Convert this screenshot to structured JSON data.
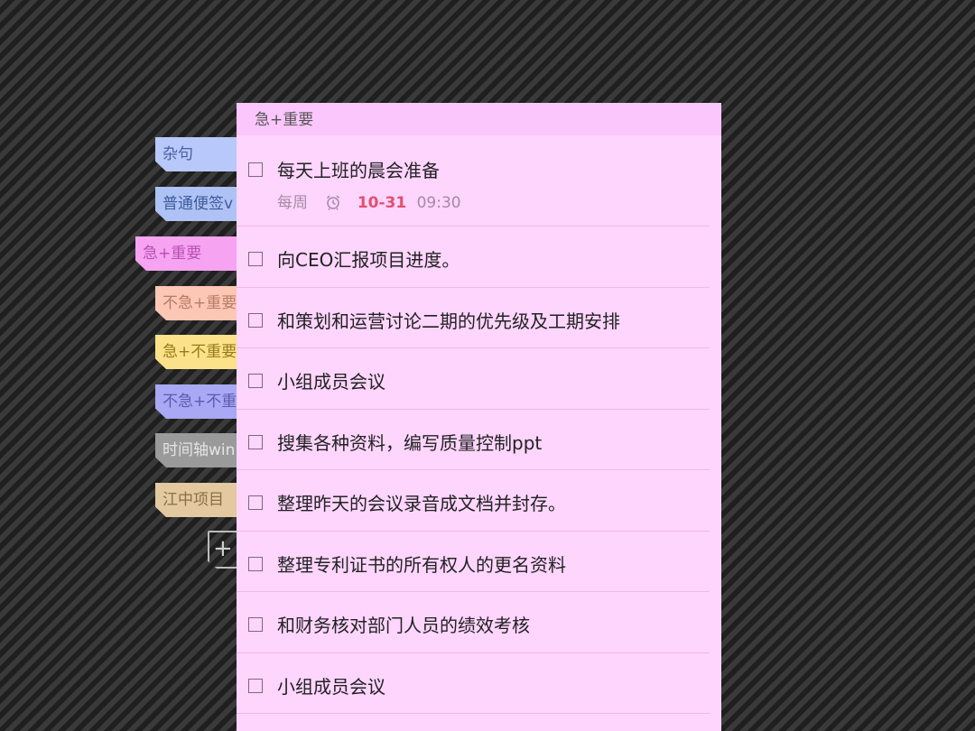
{
  "tabs": [
    {
      "label": "杂句",
      "bg": "#b8c8fa",
      "color": "#4a5fa0"
    },
    {
      "label": "普通便签v",
      "bg": "#aec2f5",
      "color": "#3f5a9a"
    },
    {
      "label": "急+重要",
      "bg": "#f6a3f2",
      "color": "#b84fb2"
    },
    {
      "label": "不急+重要",
      "bg": "#fcc7b4",
      "color": "#b87b66"
    },
    {
      "label": "急+不重要",
      "bg": "#fbe28a",
      "color": "#9a7a1a"
    },
    {
      "label": "不急+不重",
      "bg": "#a9a8f4",
      "color": "#5c5ab0"
    },
    {
      "label": "时间轴win",
      "bg": "#9a9a9a",
      "color": "#e4e4e4"
    },
    {
      "label": "江中项目",
      "bg": "#e2c9a0",
      "color": "#8a6f43"
    }
  ],
  "add_button": {
    "label": "+"
  },
  "panel": {
    "title": "急+重要",
    "tasks": [
      {
        "title": "每天上班的晨会准备",
        "repeat": "每周",
        "date": "10-31",
        "time": "09:30"
      },
      {
        "title": "向CEO汇报项目进度。"
      },
      {
        "title": "和策划和运营讨论二期的优先级及工期安排"
      },
      {
        "title": "小组成员会议"
      },
      {
        "title": "搜集各种资料，编写质量控制ppt"
      },
      {
        "title": "整理昨天的会议录音成文档并封存。"
      },
      {
        "title": "整理专利证书的所有权人的更名资料"
      },
      {
        "title": "和财务核对部门人员的绩效考核"
      },
      {
        "title": "小组成员会议"
      }
    ]
  }
}
